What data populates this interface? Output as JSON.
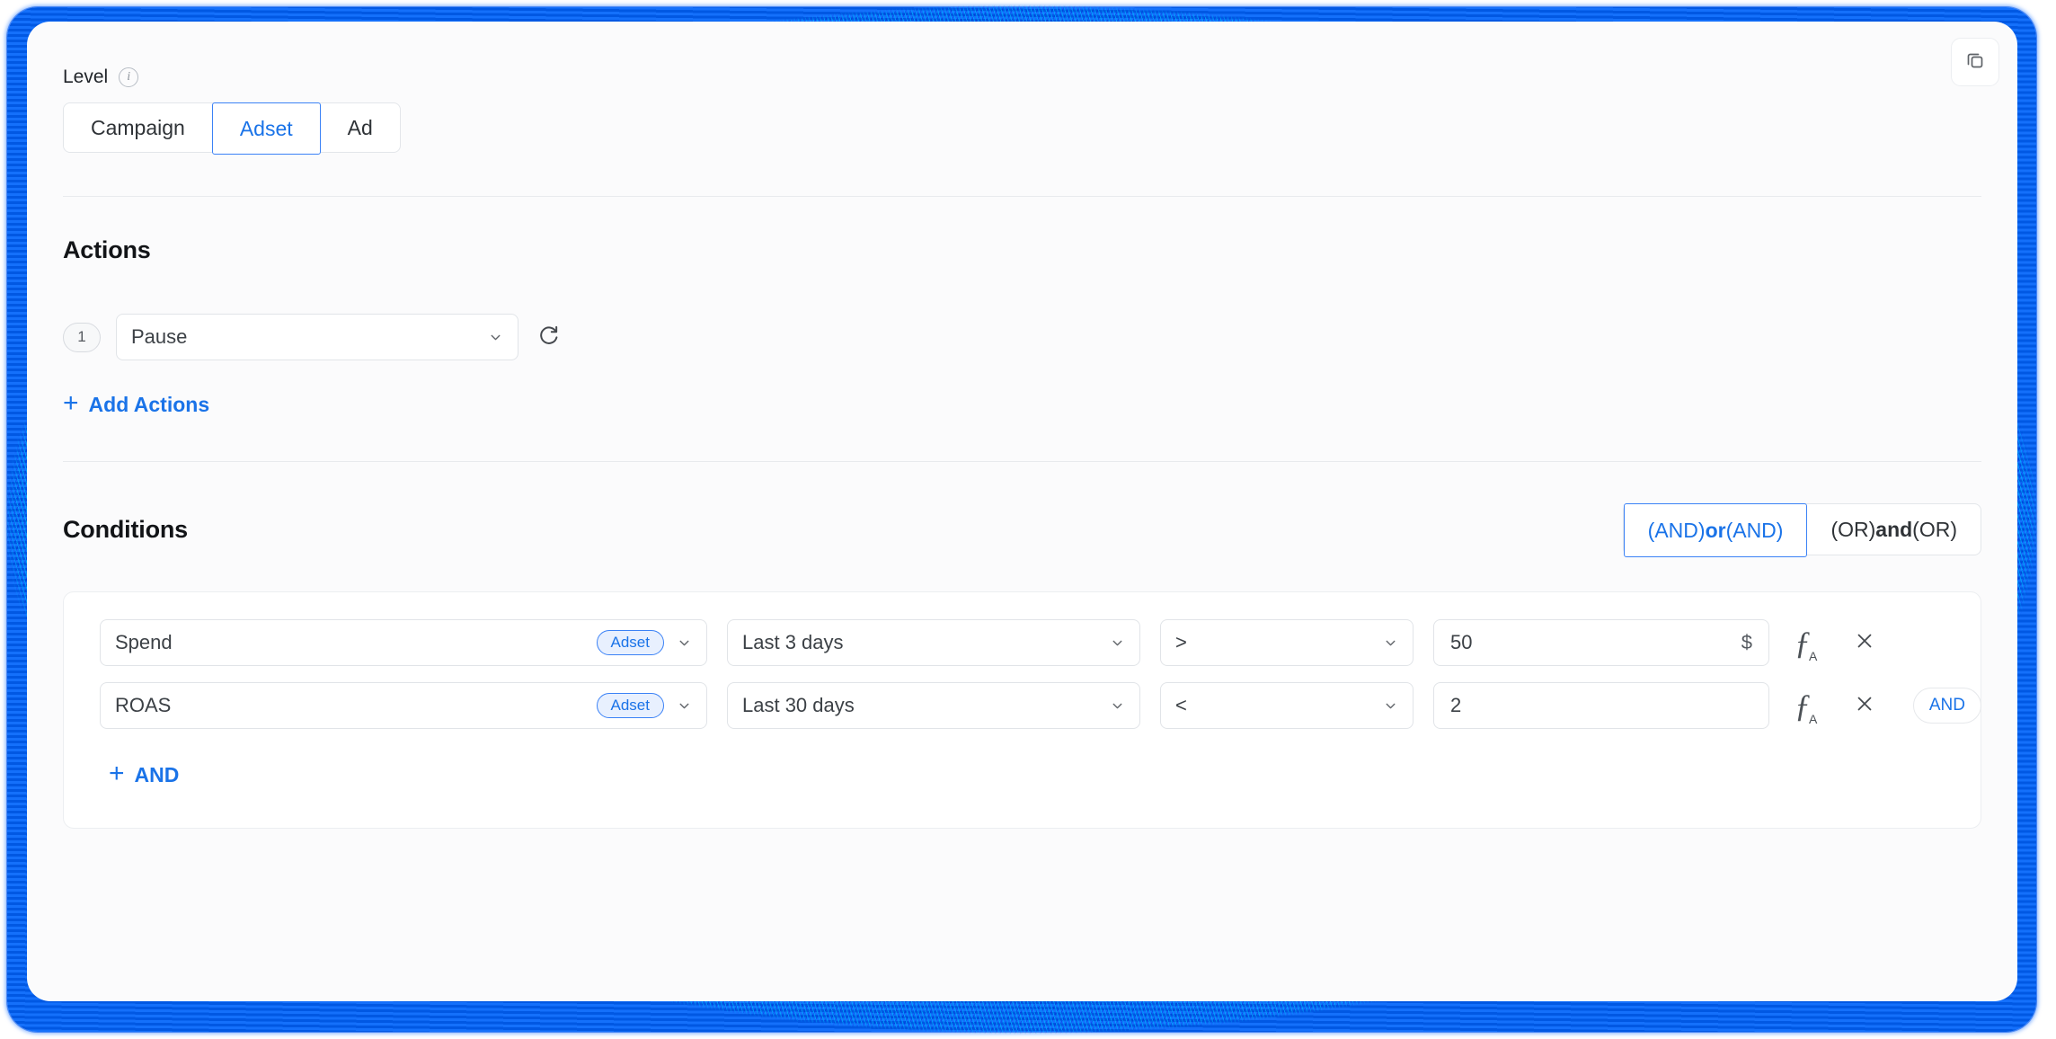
{
  "panel": {
    "copy_button_label": "copy-icon"
  },
  "level": {
    "label": "Level",
    "info_icon": "info-icon",
    "options": [
      {
        "label": "Campaign",
        "active": false
      },
      {
        "label": "Adset",
        "active": true
      },
      {
        "label": "Ad",
        "active": false
      }
    ]
  },
  "actions": {
    "heading": "Actions",
    "rows": [
      {
        "step": "1",
        "value": "Pause",
        "refresh_icon": "refresh-icon"
      }
    ],
    "add_label": "Add Actions",
    "add_plus": "+"
  },
  "conditions": {
    "heading": "Conditions",
    "logic_modes": [
      {
        "prefix": "(AND) ",
        "emphasis": "or",
        "suffix": " (AND)",
        "active": true
      },
      {
        "prefix": "(OR) ",
        "emphasis": "and",
        "suffix": " (OR)",
        "active": false
      }
    ],
    "rows": [
      {
        "metric": "Spend",
        "scope_badge": "Adset",
        "date_range": "Last 3 days",
        "operator": ">",
        "value": "50",
        "unit": "$",
        "formula_icon": "fx-icon",
        "remove_icon": "close-icon",
        "join_badge": ""
      },
      {
        "metric": "ROAS",
        "scope_badge": "Adset",
        "date_range": "Last 30 days",
        "operator": "<",
        "value": "2",
        "unit": "",
        "formula_icon": "fx-icon",
        "remove_icon": "close-icon",
        "join_badge": "AND"
      }
    ],
    "add_label": "AND",
    "add_plus": "+"
  },
  "colors": {
    "accent": "#1a73e8",
    "accent_border": "#3b82f6",
    "highlight_frame": "#1557d6",
    "text": "#1f2328",
    "muted": "#8b9199",
    "border": "#e1e4e8"
  }
}
